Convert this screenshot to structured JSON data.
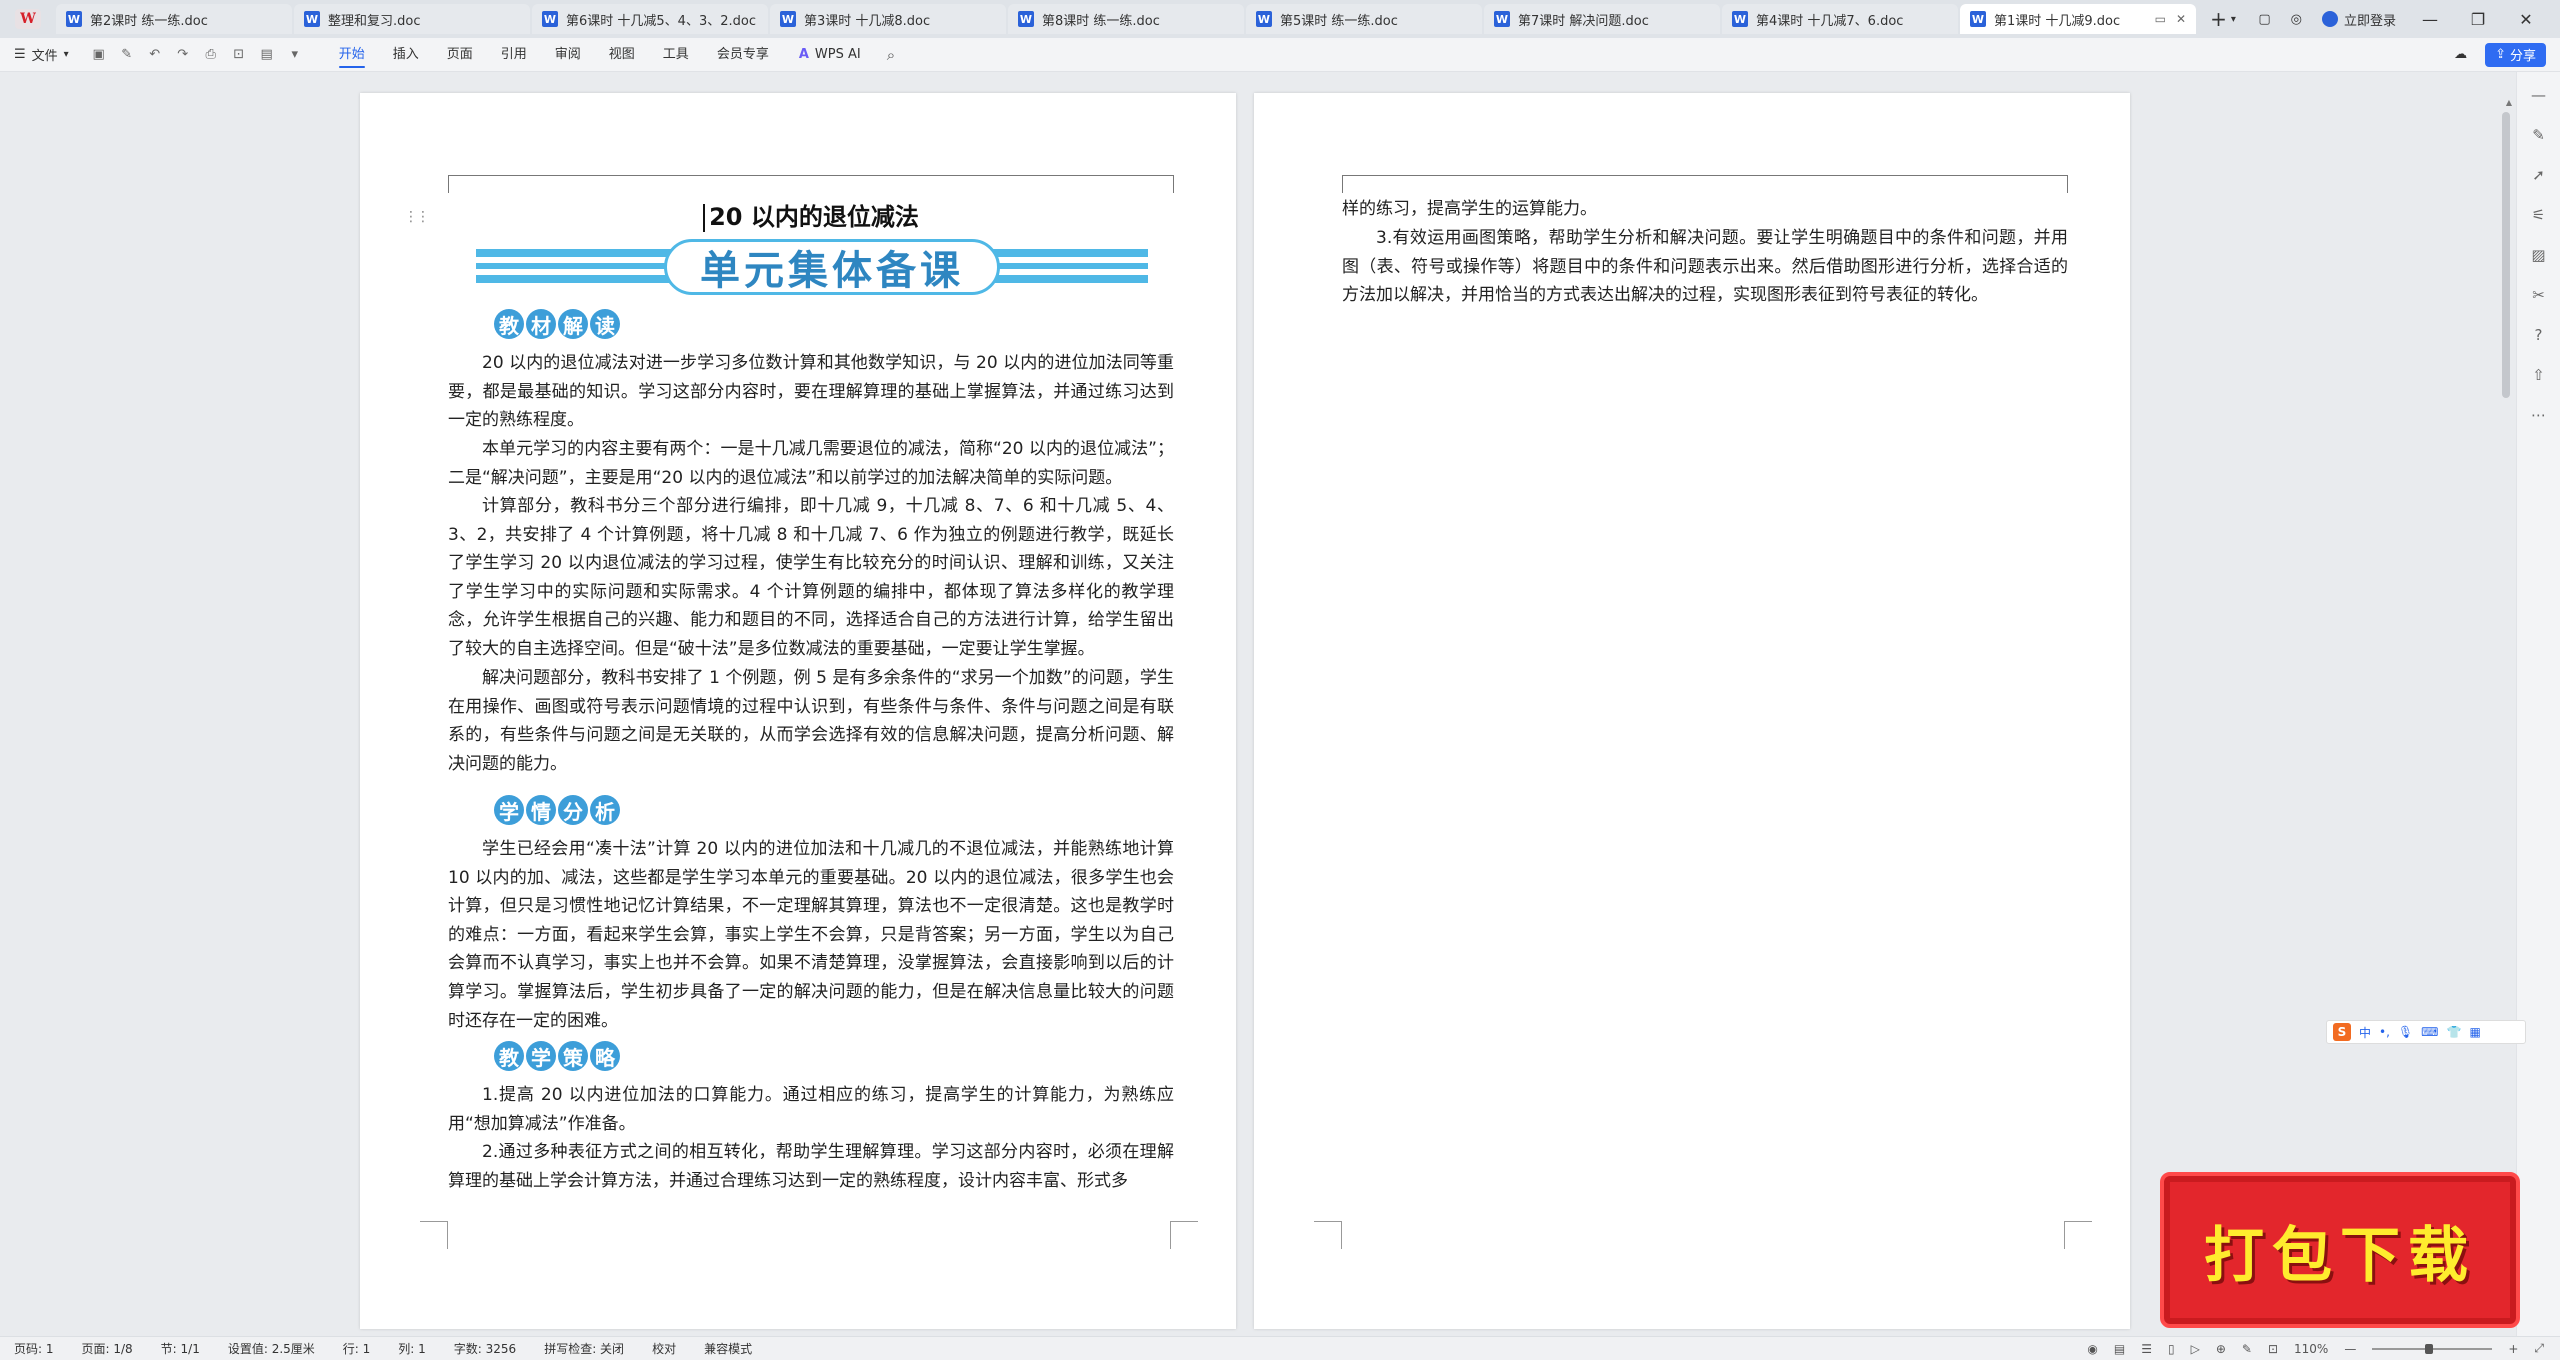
{
  "tabs": [
    {
      "title": "第2课时 练一练.doc"
    },
    {
      "title": "整理和复习.doc"
    },
    {
      "title": "第6课时 十几减5、4、3、2.doc"
    },
    {
      "title": "第3课时 十几减8.doc"
    },
    {
      "title": "第8课时 练一练.doc"
    },
    {
      "title": "第5课时 练一练.doc"
    },
    {
      "title": "第7课时 解决问题.doc"
    },
    {
      "title": "第4课时 十几减7、6.doc"
    },
    {
      "title": "第1课时 十几减9.doc",
      "active": true
    }
  ],
  "titlebar": {
    "login": "立即登录",
    "new_tab": "+"
  },
  "menu": {
    "file": "文件",
    "tabs": [
      "开始",
      "插入",
      "页面",
      "引用",
      "审阅",
      "视图",
      "工具",
      "会员专享"
    ],
    "wps_ai": "WPS AI",
    "share": "分享"
  },
  "doc": {
    "title": "20 以内的退位减法",
    "banner": "单元集体备课",
    "sections": {
      "s1": [
        "教",
        "材",
        "解",
        "读"
      ],
      "s2": [
        "学",
        "情",
        "分",
        "析"
      ],
      "s3": [
        "教",
        "学",
        "策",
        "略"
      ]
    },
    "p1": "20 以内的退位减法对进一步学习多位数计算和其他数学知识，与 20 以内的进位加法同等重要，都是最基础的知识。学习这部分内容时，要在理解算理的基础上掌握算法，并通过练习达到一定的熟练程度。",
    "p2": "本单元学习的内容主要有两个：一是十几减几需要退位的减法，简称“20 以内的退位减法”；二是“解决问题”，主要是用“20 以内的退位减法”和以前学过的加法解决简单的实际问题。",
    "p3": "计算部分，教科书分三个部分进行编排，即十几减 9，十几减 8、7、6 和十几减 5、4、3、2，共安排了 4 个计算例题，将十几减 8 和十几减 7、6 作为独立的例题进行教学，既延长了学生学习 20 以内退位减法的学习过程，使学生有比较充分的时间认识、理解和训练，又关注了学生学习中的实际问题和实际需求。4 个计算例题的编排中，都体现了算法多样化的教学理念，允许学生根据自己的兴趣、能力和题目的不同，选择适合自己的方法进行计算，给学生留出了较大的自主选择空间。但是“破十法”是多位数减法的重要基础，一定要让学生掌握。",
    "p4": "解决问题部分，教科书安排了 1 个例题，例 5 是有多余条件的“求另一个加数”的问题，学生在用操作、画图或符号表示问题情境的过程中认识到，有些条件与条件、条件与问题之间是有联系的，有些条件与问题之间是无关联的，从而学会选择有效的信息解决问题，提高分析问题、解决问题的能力。",
    "p5": "学生已经会用“凑十法”计算 20 以内的进位加法和十几减几的不退位减法，并能熟练地计算 10 以内的加、减法，这些都是学生学习本单元的重要基础。20 以内的退位减法，很多学生也会计算，但只是习惯性地记忆计算结果，不一定理解其算理，算法也不一定很清楚。这也是教学时的难点：一方面，看起来学生会算，事实上学生不会算，只是背答案；另一方面，学生以为自己会算而不认真学习，事实上也并不会算。如果不清楚算理，没掌握算法，会直接影响到以后的计算学习。掌握算法后，学生初步具备了一定的解决问题的能力，但是在解决信息量比较大的问题时还存在一定的困难。",
    "p6": "1.提高 20 以内进位加法的口算能力。通过相应的练习，提高学生的计算能力，为熟练应用“想加算减法”作准备。",
    "p7": "2.通过多种表征方式之间的相互转化，帮助学生理解算理。学习这部分内容时，必须在理解算理的基础上学会计算方法，并通过合理练习达到一定的熟练程度，设计内容丰富、形式多",
    "p8": "样的练习，提高学生的运算能力。",
    "p9": "3.有效运用画图策略，帮助学生分析和解决问题。要让学生明确题目中的条件和问题，并用图（表、符号或操作等）将题目中的条件和问题表示出来。然后借助图形进行分析，选择合适的方法加以解决，并用恰当的方式表达出解决的过程，实现图形表征到符号表征的转化。"
  },
  "status": {
    "page_code": "页码: 1",
    "page": "页面: 1/8",
    "section": "节: 1/1",
    "setting": "设置值: 2.5厘米",
    "row": "行: 1",
    "col": "列: 1",
    "words": "字数: 3256",
    "spell": "拼写检查: 关闭",
    "proof": "校对",
    "compat": "兼容模式",
    "zoom": "110%",
    "zoom_fraction": 0.47
  },
  "ime": {
    "lang": "中"
  },
  "promo": {
    "text": "打包下载"
  },
  "colors": {
    "accent": "#2463eb",
    "banner": "#4fb8e6",
    "promo": "#e3262c"
  }
}
